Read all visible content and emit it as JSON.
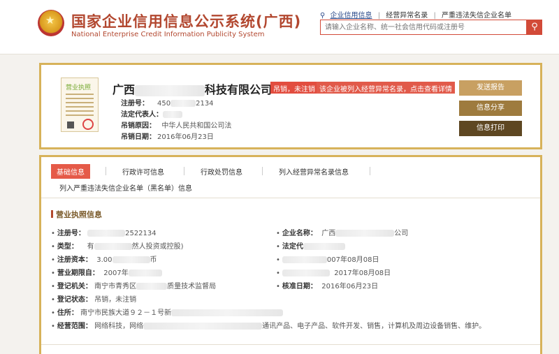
{
  "header": {
    "title": "国家企业信用信息公示系统(广西)",
    "subtitle": "National Enterprise Credit Information Publicity System",
    "search_tabs": [
      "企业信用信息",
      "经营异常名录",
      "严重违法失信企业名单"
    ],
    "search_placeholder": "请输入企业名称、统一社会信用代码或注册号"
  },
  "company": {
    "license_label": "营业执照",
    "name_prefix": "广西",
    "name_suffix": "科技有限公司",
    "status_tag": "吊销，未注销",
    "alert_tag": "该企业被列入经营异常名录，点击查看详情",
    "reg_no_label": "注册号：",
    "reg_no_a": "450",
    "reg_no_b": "2134",
    "legal_rep_label": "法定代表人：",
    "legal_rep_value": "",
    "revoke_reason_label": "吊销原因：",
    "revoke_reason_value": "中华人民共和国公司法",
    "revoke_date_label": "吊销日期：",
    "revoke_date_value": "2016年06月23日",
    "buttons": [
      "发送报告",
      "信息分享",
      "信息打印"
    ]
  },
  "tabs": {
    "items": [
      "基础信息",
      "行政许可信息",
      "行政处罚信息",
      "列入经营异常名录信息",
      "列入严重违法失信企业名单（黑名单）信息"
    ]
  },
  "basic_info": {
    "section_title": "营业执照信息",
    "left": [
      {
        "label": "注册号：",
        "value": "2522134"
      },
      {
        "label": "类型：",
        "value": "有",
        "value2": "然人投资或控股)"
      },
      {
        "label": "注册资本：",
        "value": "3.00",
        "value2": "币"
      },
      {
        "label": "营业期限自：",
        "value": "2007年"
      },
      {
        "label": "登记机关：",
        "value": "南宁市青秀区",
        "value2": "质量技术监督局"
      },
      {
        "label": "登记状态：",
        "value": "吊销，未注销"
      },
      {
        "label": "住所：",
        "value": "南宁市民族大道９２－１号新"
      },
      {
        "label": "经营范围：",
        "value": "网络科技，网络",
        "value2": "通讯产品、电子产品、软件开发、销售，计算机及周边设备销售、维护。"
      }
    ],
    "right": [
      {
        "label": "企业名称：",
        "value": "广西",
        "value2": "公司"
      },
      {
        "label": "法定代",
        "value": ""
      },
      {
        "label": "",
        "value": "007年08月08日"
      },
      {
        "label": "",
        "value": "2017年08月08日"
      },
      {
        "label": "核准日期：",
        "value": "2016年06月23日"
      }
    ]
  }
}
